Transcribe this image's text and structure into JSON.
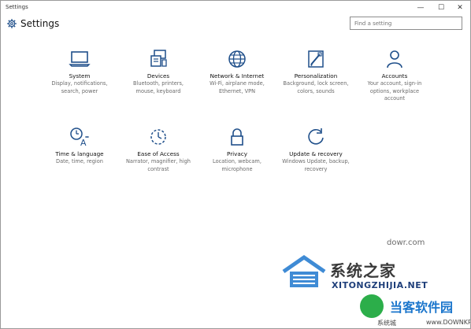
{
  "window": {
    "title": "Settings",
    "controls": {
      "minimize": "—",
      "maximize": "☐",
      "close": "✕"
    }
  },
  "header": {
    "heading": "Settings",
    "search_placeholder": "Find a setting"
  },
  "tiles": [
    {
      "name": "System",
      "desc": "Display, notifications, search, power",
      "icon": "monitor-icon"
    },
    {
      "name": "Devices",
      "desc": "Bluetooth, printers, mouse, keyboard",
      "icon": "devices-icon"
    },
    {
      "name": "Network & Internet",
      "desc": "Wi-Fi, airplane mode, Ethernet, VPN",
      "icon": "globe-icon"
    },
    {
      "name": "Personalization",
      "desc": "Background, lock screen, colors, sounds",
      "icon": "paintbrush-icon"
    },
    {
      "name": "Accounts",
      "desc": "Your account, sign-in options, workplace account",
      "icon": "person-icon"
    },
    {
      "name": "Time & language",
      "desc": "Date, time, region",
      "icon": "time-language-icon"
    },
    {
      "name": "Ease of Access",
      "desc": "Narrator, magnifier, high contrast",
      "icon": "ease-of-access-icon"
    },
    {
      "name": "Privacy",
      "desc": "Location, webcam, microphone",
      "icon": "lock-icon"
    },
    {
      "name": "Update & recovery",
      "desc": "Windows Update, backup, recovery",
      "icon": "refresh-icon"
    }
  ],
  "watermark": {
    "cn": "系统之家",
    "en": "XITONGZHIJIA.NET",
    "url": "dowr.com",
    "badge": "当客软件园",
    "small": "系统城",
    "domain": "www.DOWNKR.com"
  },
  "colors": {
    "accent": "#1f4f8a",
    "icon": "#1f4f8a"
  }
}
